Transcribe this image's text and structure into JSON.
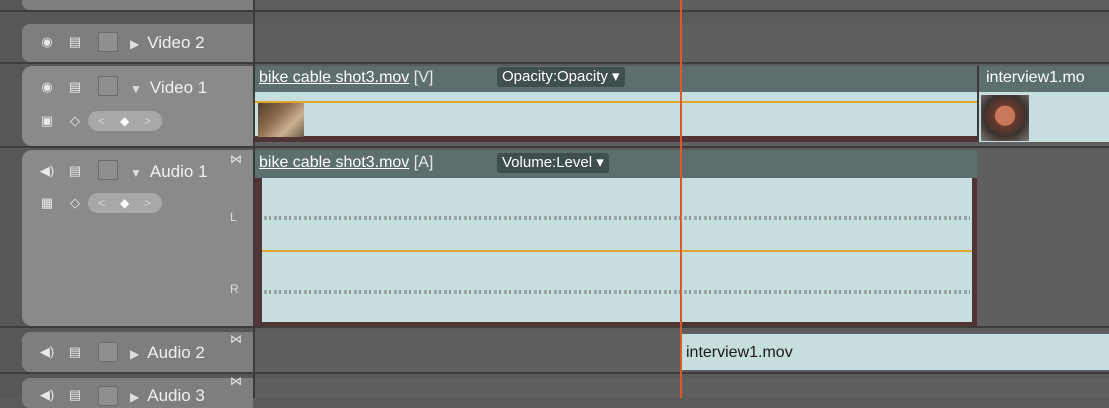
{
  "tracks": {
    "video2": {
      "name": "Video 2"
    },
    "video1": {
      "name": "Video 1"
    },
    "audio1": {
      "name": "Audio 1",
      "channel_left": "L",
      "channel_right": "R"
    },
    "audio2": {
      "name": "Audio 2"
    },
    "audio3": {
      "name": "Audio 3"
    }
  },
  "clips": {
    "video1_clip1": {
      "filename": "bike cable shot3.mov",
      "tag": "[V]",
      "effect": "Opacity:Opacity"
    },
    "video1_clip2": {
      "filename": "interview1.mo"
    },
    "audio1_clip1": {
      "filename": "bike cable shot3.mov",
      "tag": "[A]",
      "effect": "Volume:Level"
    },
    "audio2_clip1": {
      "filename": "interview1.mov"
    }
  },
  "icons": {
    "toggle_output": "eye-icon",
    "toggle_lock": "film-icon",
    "speaker": "speaker-icon",
    "keyframe_nav": "keyframe-diamond-icon"
  },
  "colors": {
    "clip_header": "#5c6e6e",
    "clip_body": "#c6dedd",
    "playhead": "#e0572a",
    "rubber_band": "#e0a62e"
  }
}
